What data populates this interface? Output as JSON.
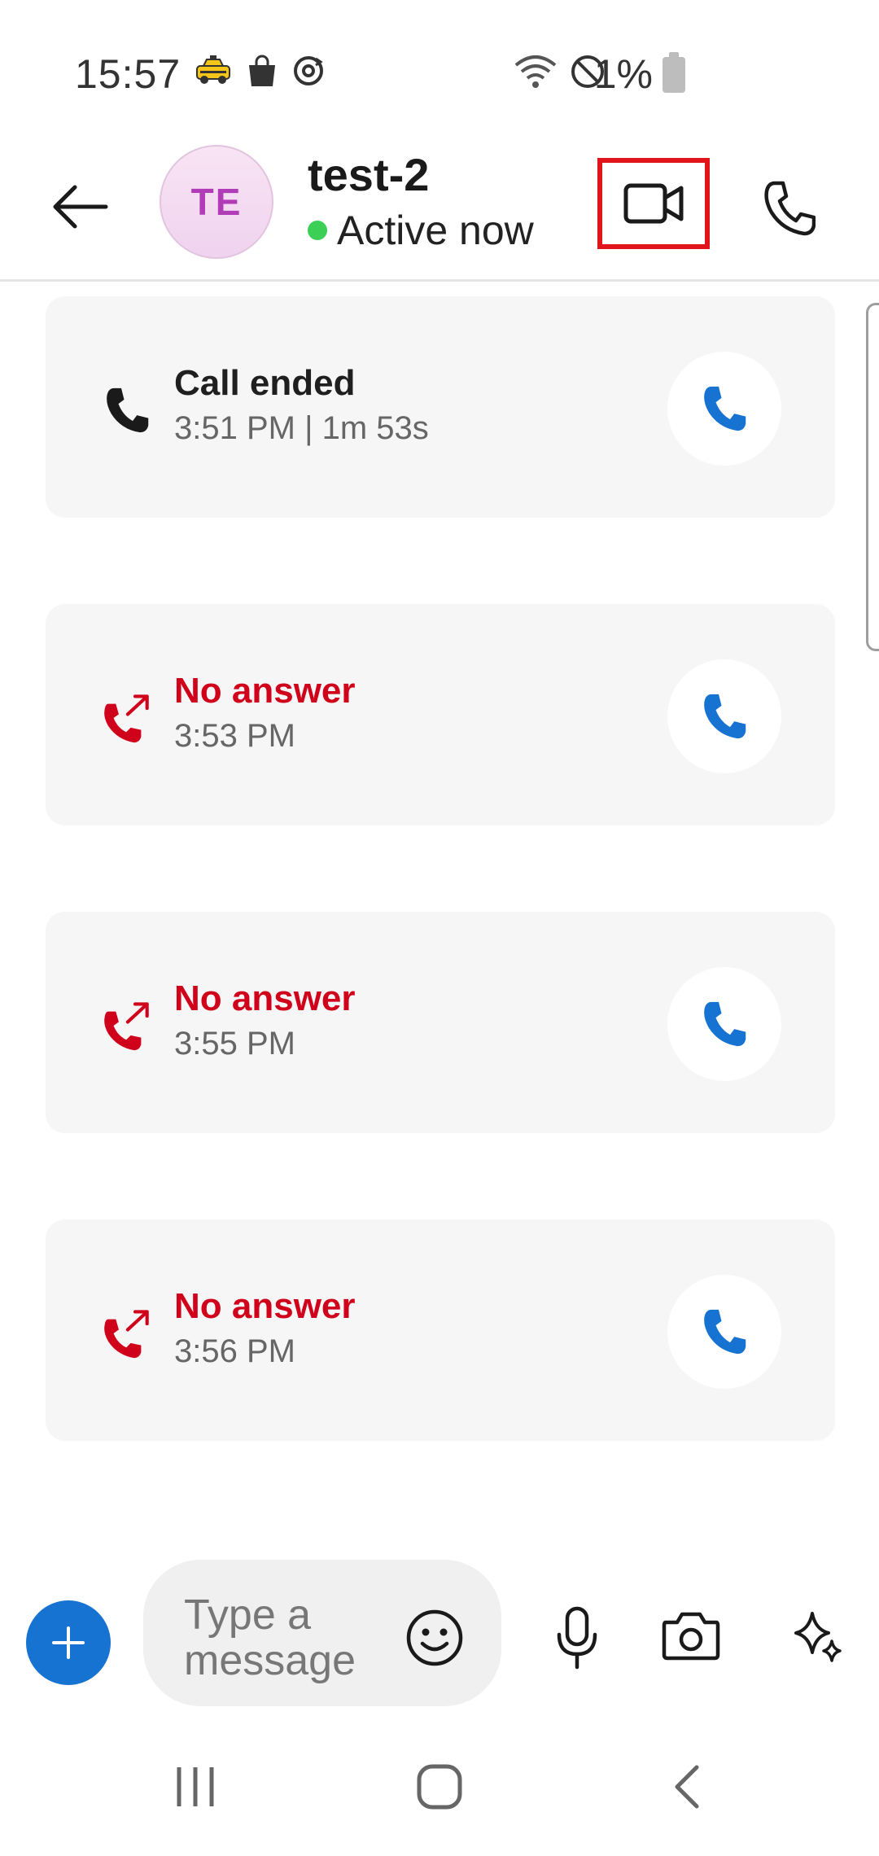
{
  "status_bar": {
    "time": "15:57",
    "battery_percent": "1%",
    "left_icons": [
      "taxi-icon",
      "shopping-bag-icon",
      "sync-icon"
    ],
    "right_icons": [
      "wifi-icon",
      "do-not-disturb-icon",
      "battery-icon"
    ]
  },
  "header": {
    "avatar_initials": "TE",
    "contact_name": "test-2",
    "presence_text": "Active now",
    "presence_color": "#3ccf55",
    "video_button_highlight_color": "#e1141b"
  },
  "calls": [
    {
      "status": "ended",
      "title": "Call ended",
      "subtitle": "3:51 PM | 1m 53s",
      "icon": "phone-icon"
    },
    {
      "status": "missed",
      "title": "No answer",
      "subtitle": "3:53 PM",
      "icon": "missed-call-icon"
    },
    {
      "status": "missed",
      "title": "No answer",
      "subtitle": "3:55 PM",
      "icon": "missed-call-icon"
    },
    {
      "status": "missed",
      "title": "No answer",
      "subtitle": "3:56 PM",
      "icon": "missed-call-icon"
    }
  ],
  "composer": {
    "placeholder": "Type a message",
    "accent_color": "#1773d1"
  },
  "colors": {
    "missed": "#d0021b",
    "callback": "#1773d1",
    "card_bg": "#f6f6f6"
  }
}
